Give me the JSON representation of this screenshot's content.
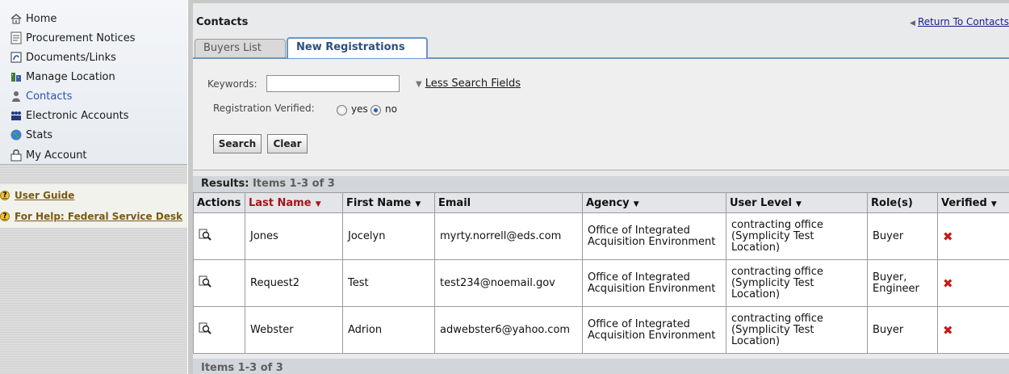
{
  "sidebar": {
    "items": [
      {
        "label": "Home",
        "icon": "home-icon"
      },
      {
        "label": "Procurement Notices",
        "icon": "notice-icon"
      },
      {
        "label": "Documents/Links",
        "icon": "documents-icon"
      },
      {
        "label": "Manage Location",
        "icon": "location-icon"
      },
      {
        "label": "Contacts",
        "icon": "contacts-icon",
        "active": true
      },
      {
        "label": "Electronic Accounts",
        "icon": "accounts-icon"
      },
      {
        "label": "Stats",
        "icon": "stats-icon"
      },
      {
        "label": "My Account",
        "icon": "account-icon"
      }
    ],
    "help": [
      {
        "label": "User Guide",
        "icon": "help-icon"
      },
      {
        "label": "For Help: Federal Service Desk",
        "icon": "help-icon"
      }
    ],
    "active_color": "#2b4fb6"
  },
  "header": {
    "title": "Contacts",
    "return_link": "Return To Contacts"
  },
  "tabs": [
    {
      "label": "Buyers List",
      "active": false
    },
    {
      "label": "New Registrations",
      "active": true
    }
  ],
  "search": {
    "keywords_label": "Keywords:",
    "keywords_value": "",
    "less_fields_link": "Less Search Fields",
    "verified_label": "Registration Verified:",
    "yes_label": "yes",
    "no_label": "no",
    "selected": "no",
    "search_button": "Search",
    "clear_button": "Clear"
  },
  "results": {
    "label": "Results:",
    "count_text": "Items 1-3 of 3",
    "columns": [
      "Actions",
      "Last Name",
      "First Name",
      "Email",
      "Agency",
      "User Level",
      "Role(s)",
      "Verified"
    ],
    "sorted_column": "Last Name",
    "rows": [
      {
        "last": "Jones",
        "first": "Jocelyn",
        "email": "myrty.norrell@eds.com",
        "agency": "Office of Integrated Acquisition Environment",
        "level": "contracting office (Symplicity Test Location)",
        "roles": "Buyer",
        "verified": false
      },
      {
        "last": "Request2",
        "first": "Test",
        "email": "test234@noemail.gov",
        "agency": "Office of Integrated Acquisition Environment",
        "level": "contracting office (Symplicity Test Location)",
        "roles": "Buyer, Engineer",
        "verified": false
      },
      {
        "last": "Webster",
        "first": "Adrion",
        "email": "adwebster6@yahoo.com",
        "agency": "Office of Integrated Acquisition Environment",
        "level": "contracting office (Symplicity Test Location)",
        "roles": "Buyer",
        "verified": false
      }
    ],
    "footer_text": "Items 1-3 of 3",
    "unverified_icon": "x-icon",
    "unverified_color": "#c51a1a"
  }
}
